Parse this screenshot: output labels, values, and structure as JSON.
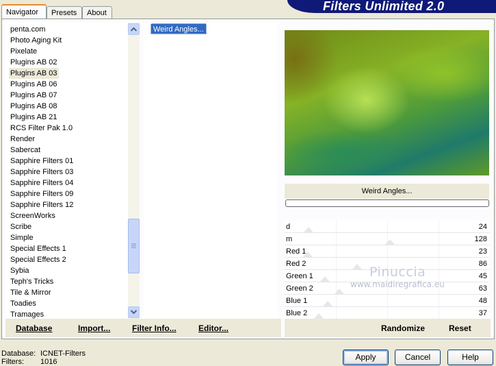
{
  "tabs": [
    {
      "label": "Navigator",
      "active": true
    },
    {
      "label": "Presets",
      "active": false
    },
    {
      "label": "About",
      "active": false
    }
  ],
  "app_title": "Filters Unlimited 2.0",
  "categories": [
    "penta.com",
    "Photo Aging Kit",
    "Pixelate",
    "Plugins AB 02",
    "Plugins AB 03",
    "Plugins AB 06",
    "Plugins AB 07",
    "Plugins AB 08",
    "Plugins AB 21",
    "RCS Filter Pak 1.0",
    "Render",
    "Sabercat",
    "Sapphire Filters 01",
    "Sapphire Filters 03",
    "Sapphire Filters 04",
    "Sapphire Filters 09",
    "Sapphire Filters 12",
    "ScreenWorks",
    "Scribe",
    "Simple",
    "Special Effects 1",
    "Special Effects 2",
    "Sybia",
    "Teph's Tricks",
    "Tile & Mirror",
    "Toadies",
    "Tramages"
  ],
  "selected_category": "Plugins AB 03",
  "filters": [
    "Weird Angles..."
  ],
  "selected_filter": "Weird Angles...",
  "left_buttons": {
    "database": "Database",
    "import": "Import...",
    "filter_info": "Filter Info...",
    "editor": "Editor..."
  },
  "filter_name": "Weird Angles...",
  "parameters": [
    {
      "name": "d",
      "value": 24
    },
    {
      "name": "m",
      "value": 128
    },
    {
      "name": "Red 1",
      "value": 23
    },
    {
      "name": "Red 2",
      "value": 86
    },
    {
      "name": "Green 1",
      "value": 45
    },
    {
      "name": "Green 2",
      "value": 63
    },
    {
      "name": "Blue 1",
      "value": 48
    },
    {
      "name": "Blue 2",
      "value": 37
    }
  ],
  "parameter_max": 255,
  "right_buttons": {
    "randomize": "Randomize",
    "reset": "Reset"
  },
  "watermark": {
    "name": "Pinuccia",
    "site": "www.maidiregrafica.eu"
  },
  "footer": {
    "database_label": "Database:",
    "database_value": "ICNET-Filters",
    "filters_label": "Filters:",
    "filters_value": "1016"
  },
  "dialog_buttons": {
    "apply": "Apply",
    "cancel": "Cancel",
    "help": "Help"
  }
}
